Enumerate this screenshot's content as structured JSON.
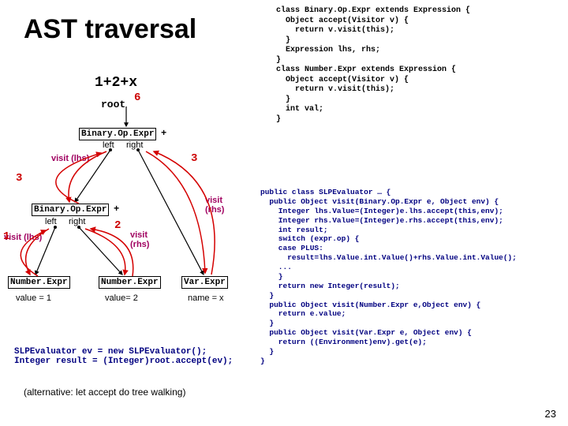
{
  "title": "AST traversal",
  "expression": "1+2+x",
  "root_label": "root",
  "root_value": "6",
  "nodes": {
    "bin1": "Binary.Op.Expr",
    "bin2": "Binary.Op.Expr",
    "num1": "Number.Expr",
    "num2": "Number.Expr",
    "var": "Var.Expr"
  },
  "ops": {
    "plus1": "+",
    "plus2": "+"
  },
  "subs": {
    "left": "left",
    "right": "right"
  },
  "edge_vals": {
    "top_right": "3",
    "mid_left": "3",
    "mid_right": "2",
    "bot_left": "1"
  },
  "visits": {
    "lhs1": "visit\n(lhs)",
    "rhs1": "visit\n(rhs)",
    "lhs2": "visit\n(lhs)",
    "rhs2": "visit\n(rhs)"
  },
  "leaves": {
    "v1": "value = 1",
    "v2": "value= 2",
    "vx": "name = x"
  },
  "code_top": "class Binary.Op.Expr extends Expression {\n  Object accept(Visitor v) {\n    return v.visit(this);\n  }\n  Expression lhs, rhs;\n}\nclass Number.Expr extends Expression {\n  Object accept(Visitor v) {\n    return v.visit(this);\n  }\n  int val;\n}",
  "code_mid": "public class SLPEvaluator … {\n  public Object visit(Binary.Op.Expr e, Object env) {\n    Integer lhs.Value=(Integer)e.lhs.accept(this,env);\n    Integer rhs.Value=(Integer)e.rhs.accept(this,env);\n    int result;\n    switch (expr.op) {\n    case PLUS:\n      result=lhs.Value.int.Value()+rhs.Value.int.Value();\n    ...\n    }\n    return new Integer(result);\n  }\n  public Object visit(Number.Expr e,Object env) {\n    return e.value;\n  }\n  public Object visit(Var.Expr e, Object env) {\n    return ((Environment)env).get(e);\n  }\n}",
  "code_bot": "SLPEvaluator ev = new SLPEvaluator();\nInteger result = (Integer)root.accept(ev);",
  "alt_text": "(alternative: let accept do tree walking)",
  "page_num": "23"
}
